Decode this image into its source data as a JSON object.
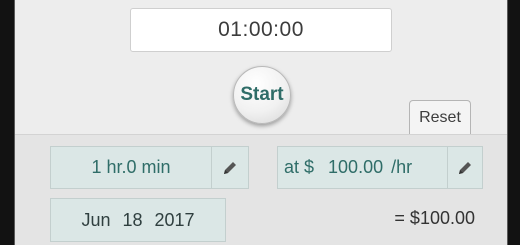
{
  "timer": {
    "display": "01:00:00"
  },
  "controls": {
    "start_label": "Start",
    "reset_label": "Reset"
  },
  "duration": {
    "value": "1 hr.0 min"
  },
  "rate": {
    "prefix": "at $",
    "amount": "100.00",
    "unit": "/hr"
  },
  "date": {
    "month": "Jun",
    "day": "18",
    "year": "2017"
  },
  "total": {
    "text": "= $100.00"
  },
  "icons": {
    "edit": "pencil-icon"
  },
  "colors": {
    "accent": "#2f6d68",
    "field_bg": "#dbe7e6"
  }
}
